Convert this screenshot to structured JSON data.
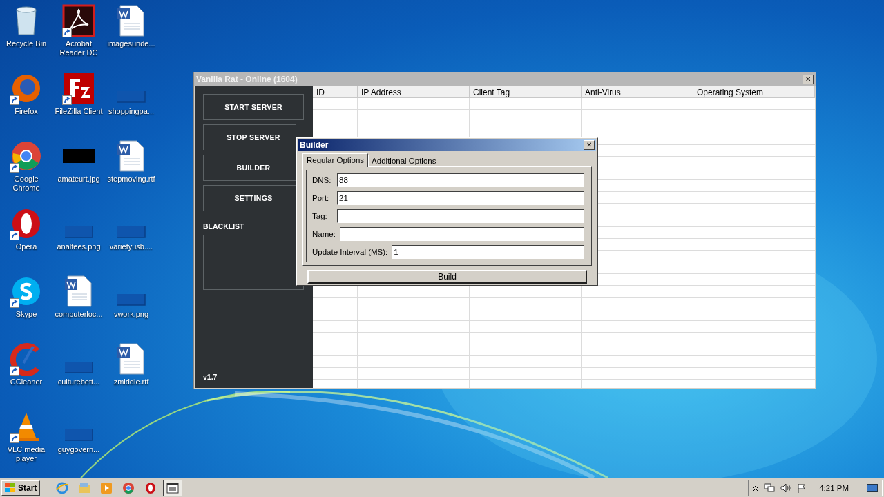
{
  "desktop": {
    "icons": [
      {
        "label": "Recycle Bin",
        "kind": "bin",
        "shortcut": false
      },
      {
        "label": "Firefox",
        "kind": "firefox",
        "shortcut": true
      },
      {
        "label": "Google Chrome",
        "kind": "chrome",
        "shortcut": true
      },
      {
        "label": "Opera",
        "kind": "opera",
        "shortcut": true
      },
      {
        "label": "Skype",
        "kind": "skype",
        "shortcut": true
      },
      {
        "label": "CCleaner",
        "kind": "ccleaner",
        "shortcut": true
      },
      {
        "label": "VLC media player",
        "kind": "vlc",
        "shortcut": true
      },
      {
        "label": "Acrobat Reader DC",
        "kind": "acrobat",
        "shortcut": true
      },
      {
        "label": "FileZilla Client",
        "kind": "filezilla",
        "shortcut": true
      },
      {
        "label": "amateurt.jpg",
        "kind": "dark-image",
        "shortcut": false
      },
      {
        "label": "analfees.png",
        "kind": "blank",
        "shortcut": false
      },
      {
        "label": "computerloc...",
        "kind": "word",
        "shortcut": false
      },
      {
        "label": "culturebett...",
        "kind": "blank",
        "shortcut": false
      },
      {
        "label": "guygovern...",
        "kind": "blank",
        "shortcut": false
      },
      {
        "label": "imagesunde...",
        "kind": "word",
        "shortcut": false
      },
      {
        "label": "shoppingpa...",
        "kind": "blank",
        "shortcut": false
      },
      {
        "label": "stepmoving.rtf",
        "kind": "word",
        "shortcut": false
      },
      {
        "label": "varietyusb....",
        "kind": "blank",
        "shortcut": false
      },
      {
        "label": "vwork.png",
        "kind": "blank",
        "shortcut": false
      },
      {
        "label": "zmiddle.rtf",
        "kind": "word",
        "shortcut": false
      }
    ]
  },
  "main_window": {
    "title": "Vanilla Rat - Online (1604)",
    "close": "✕",
    "sidebar": {
      "buttons": [
        "START SERVER",
        "STOP SERVER",
        "BUILDER",
        "SETTINGS"
      ],
      "blacklist_label": "BLACKLIST",
      "version": "v1.7"
    },
    "table": {
      "columns": [
        "ID",
        "IP Address",
        "Client Tag",
        "Anti-Virus",
        "Operating System"
      ]
    }
  },
  "builder": {
    "title": "Builder",
    "close": "✕",
    "tabs": [
      {
        "label": "Regular Options",
        "selected": true
      },
      {
        "label": "Additional Options",
        "selected": false
      }
    ],
    "fields": [
      {
        "label": "DNS:",
        "value": "88"
      },
      {
        "label": "Port:",
        "value": "21"
      },
      {
        "label": "Tag:"
      },
      {
        "label": "Name:"
      },
      {
        "label": "Update Interval (MS):",
        "value": "1"
      }
    ],
    "build_button": "Build"
  },
  "taskbar": {
    "start": "Start",
    "apps": [
      {
        "kind": "ie",
        "active": false
      },
      {
        "kind": "explorer",
        "active": false
      },
      {
        "kind": "media",
        "active": false
      },
      {
        "kind": "chrome",
        "active": false
      },
      {
        "kind": "opera",
        "active": false
      },
      {
        "kind": "app",
        "active": true
      }
    ],
    "tray": {
      "clock": "4:21 PM"
    }
  }
}
